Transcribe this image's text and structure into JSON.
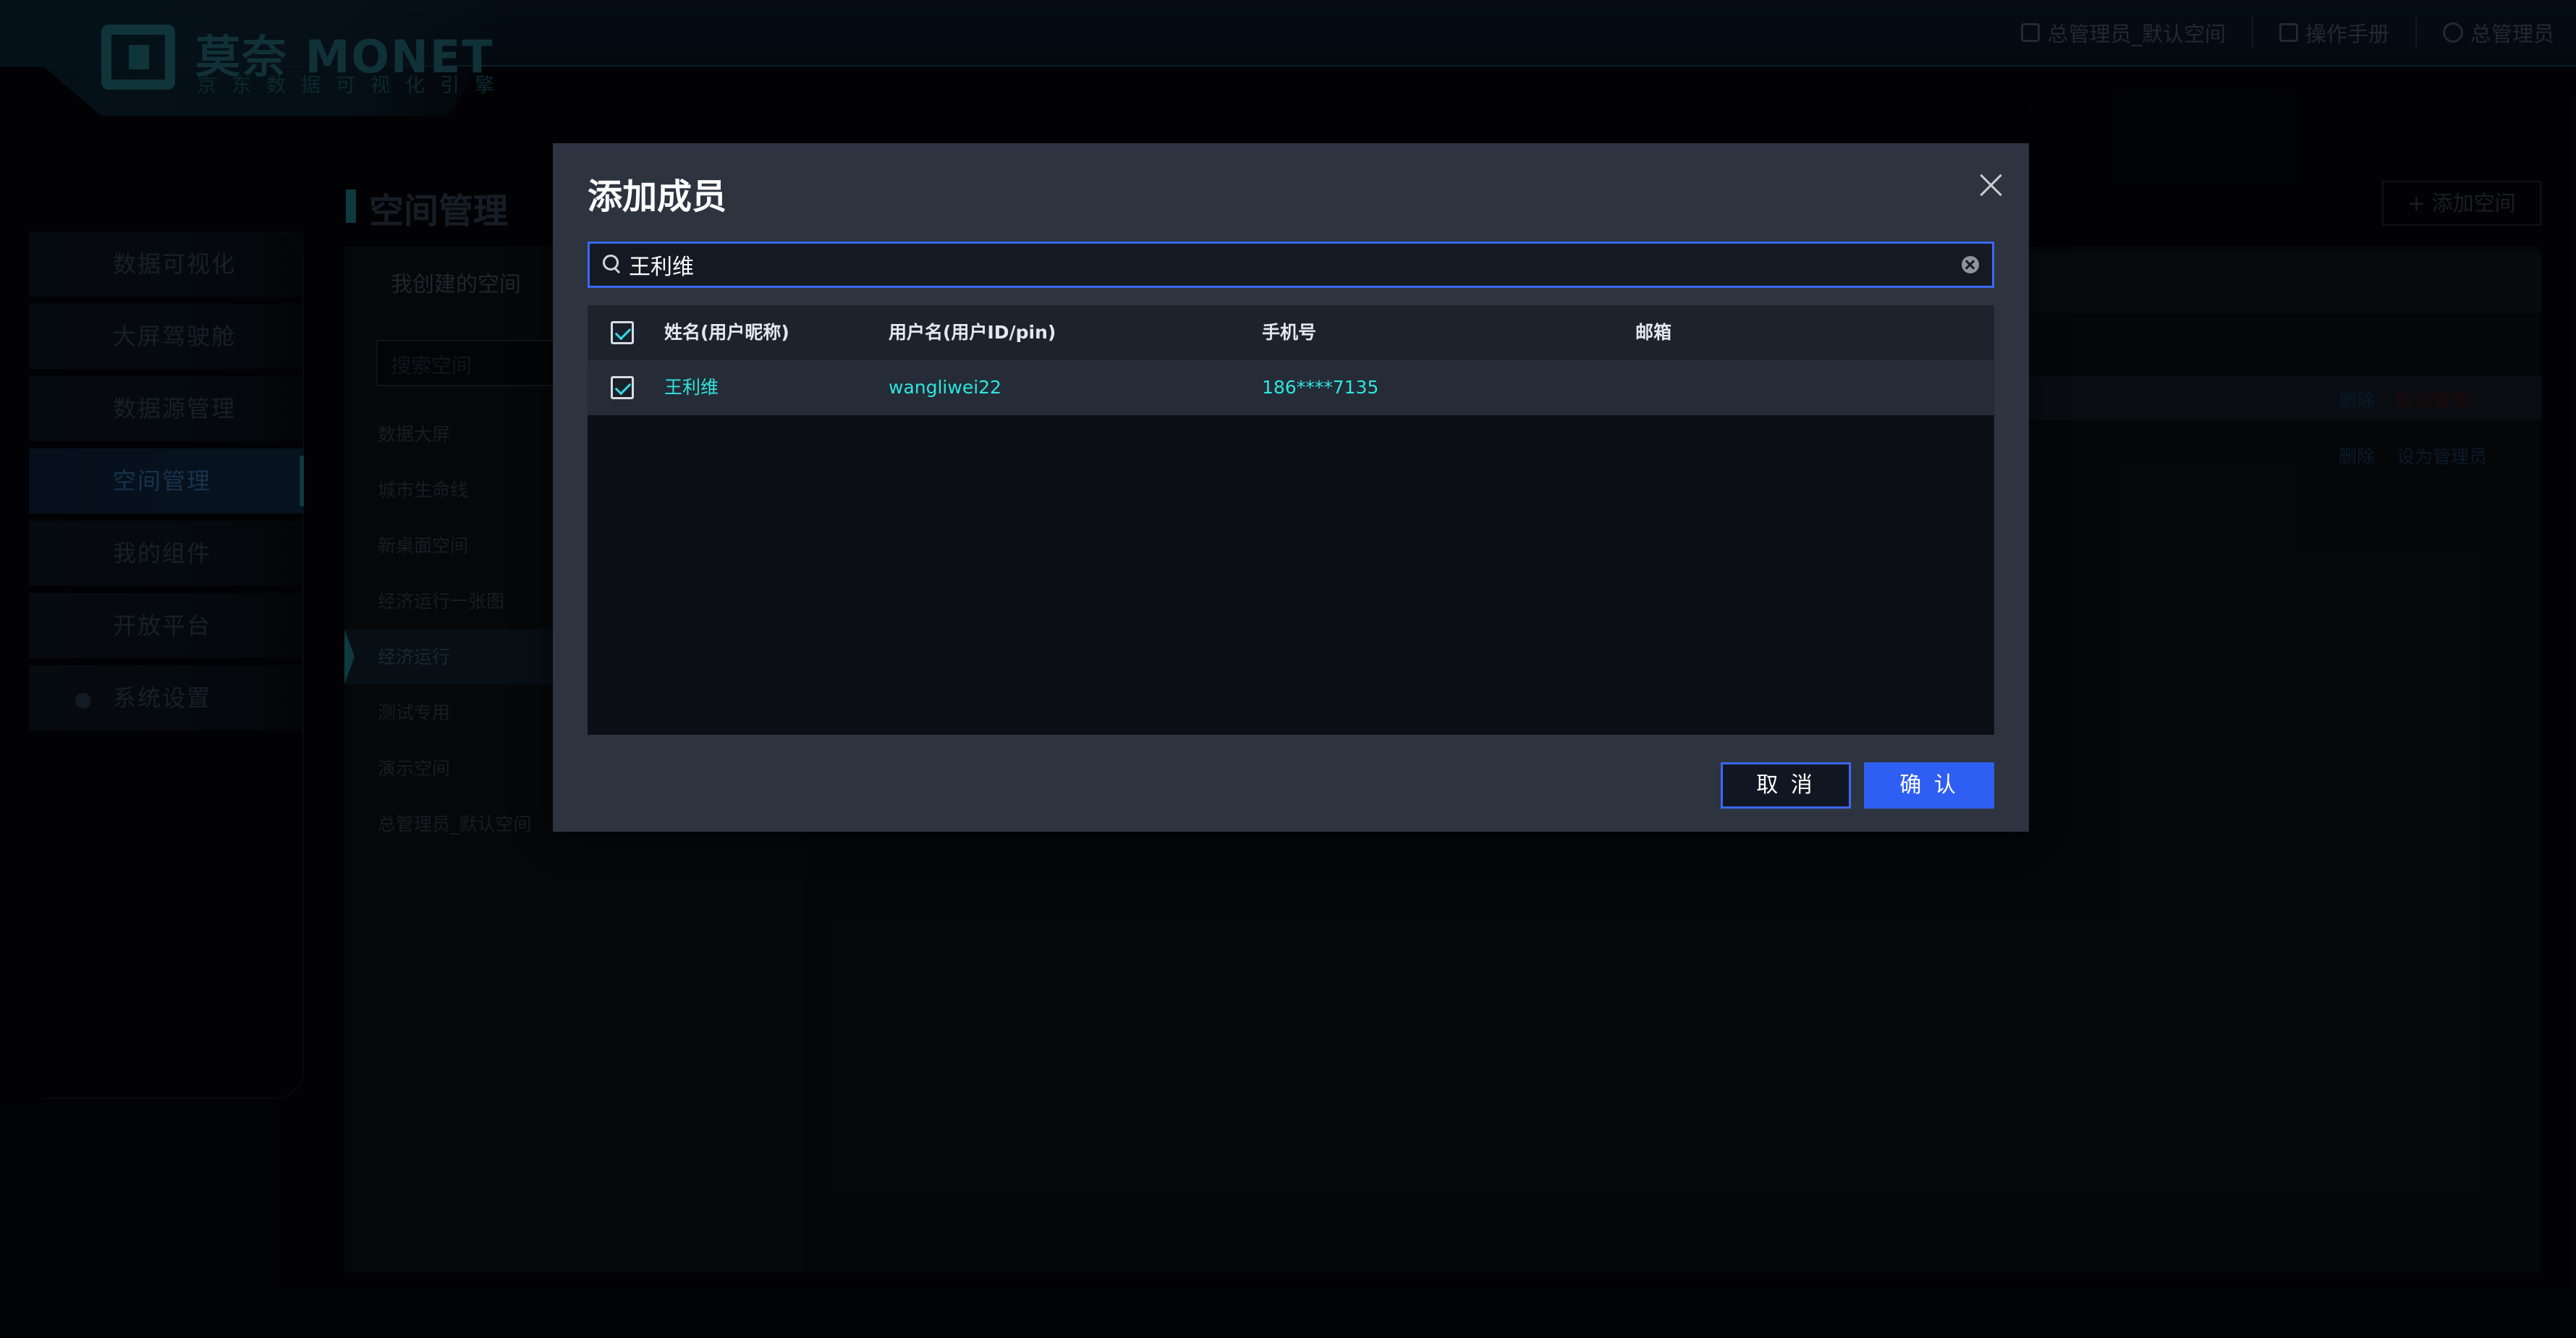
{
  "header": {
    "logo_title": "莫奈 MONET",
    "logo_subtitle": "京东数据可视化引擎",
    "nav": [
      {
        "label": "总管理员_默认空间",
        "icon": "space-icon"
      },
      {
        "label": "操作手册",
        "icon": "book-icon"
      },
      {
        "label": "总管理员",
        "icon": "user-icon"
      }
    ]
  },
  "sidebar": {
    "items": [
      {
        "label": "数据可视化"
      },
      {
        "label": "大屏驾驶舱"
      },
      {
        "label": "数据源管理"
      },
      {
        "label": "空间管理"
      },
      {
        "label": "我的组件"
      },
      {
        "label": "开放平台"
      },
      {
        "label": "系统设置"
      }
    ]
  },
  "space": {
    "title": "空间管理",
    "tab": "我创建的空间",
    "search_placeholder": "搜索空间",
    "list": [
      "数据大屏",
      "城市生命线",
      "新桌面空间",
      "经济运行一张图",
      "经济运行",
      "测试专用",
      "演示空间",
      "总管理员_默认空间"
    ]
  },
  "content": {
    "add_space_label": "+ 添加空间",
    "row1_actions": [
      "删除",
      "取消管理"
    ],
    "row2_actions": [
      "删除",
      "设为管理员"
    ]
  },
  "modal": {
    "title": "添加成员",
    "search_value": "王利维",
    "columns": [
      "姓名(用户昵称)",
      "用户名(用户ID/pin)",
      "手机号",
      "邮箱"
    ],
    "rows": [
      {
        "name": "王利维",
        "username": "wangliwei22",
        "phone": "186****7135",
        "email": ""
      }
    ],
    "cancel_label": "取 消",
    "confirm_label": "确 认"
  },
  "colors": {
    "accent": "#2f5ff2",
    "row_text": "#2ee6dd",
    "modal_bg": "#2d3440"
  }
}
